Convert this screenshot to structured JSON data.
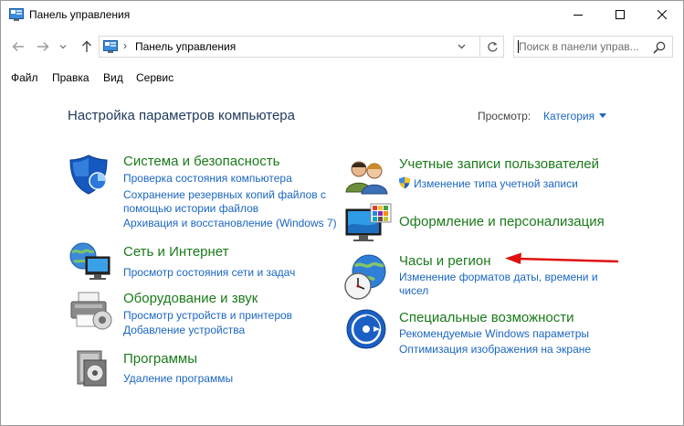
{
  "window": {
    "title": "Панель управления"
  },
  "address": {
    "separator": "›",
    "path": "Панель управления"
  },
  "search": {
    "placeholder": "Поиск в панели управ..."
  },
  "menu": {
    "file": "Файл",
    "edit": "Правка",
    "view": "Вид",
    "tools": "Сервис"
  },
  "content": {
    "title": "Настройка параметров компьютера",
    "view_label": "Просмотр:",
    "view_value": "Категория"
  },
  "categories": {
    "system": {
      "title": "Система и безопасность",
      "links": [
        "Проверка состояния компьютера",
        "Сохранение резервных копий файлов с",
        "помощью истории файлов",
        "Архивация и восстановление (Windows 7)"
      ]
    },
    "network": {
      "title": "Сеть и Интернет",
      "links": [
        "Просмотр состояния сети и задач"
      ]
    },
    "hardware": {
      "title": "Оборудование и звук",
      "links": [
        "Просмотр устройств и принтеров",
        "Добавление устройства"
      ]
    },
    "programs": {
      "title": "Программы",
      "links": [
        "Удаление программы"
      ]
    },
    "users": {
      "title": "Учетные записи пользователей",
      "links": [
        "Изменение типа учетной записи"
      ]
    },
    "appearance": {
      "title": "Оформление и персонализация",
      "links": []
    },
    "clock": {
      "title": "Часы и регион",
      "links": [
        "Изменение форматов даты, времени и",
        "чисел"
      ]
    },
    "access": {
      "title": "Специальные возможности",
      "links": [
        "Рекомендуемые Windows параметры",
        "Оптимизация изображения на экране"
      ]
    }
  },
  "colors": {
    "category_title": "#1a7a1a",
    "link": "#1a66c2",
    "page_title": "#1e395b",
    "annotation_arrow": "#e01010"
  },
  "icons": [
    "control-panel-icon",
    "back-arrow-icon",
    "forward-arrow-icon",
    "chevron-down-icon",
    "up-arrow-icon",
    "refresh-icon",
    "search-icon",
    "minimize-icon",
    "maximize-icon",
    "close-icon",
    "shield-icon",
    "network-globe-icon",
    "printer-icon",
    "programs-disc-icon",
    "users-icon",
    "uac-shield-icon",
    "display-palette-icon",
    "clock-globe-icon",
    "accessibility-icon"
  ]
}
